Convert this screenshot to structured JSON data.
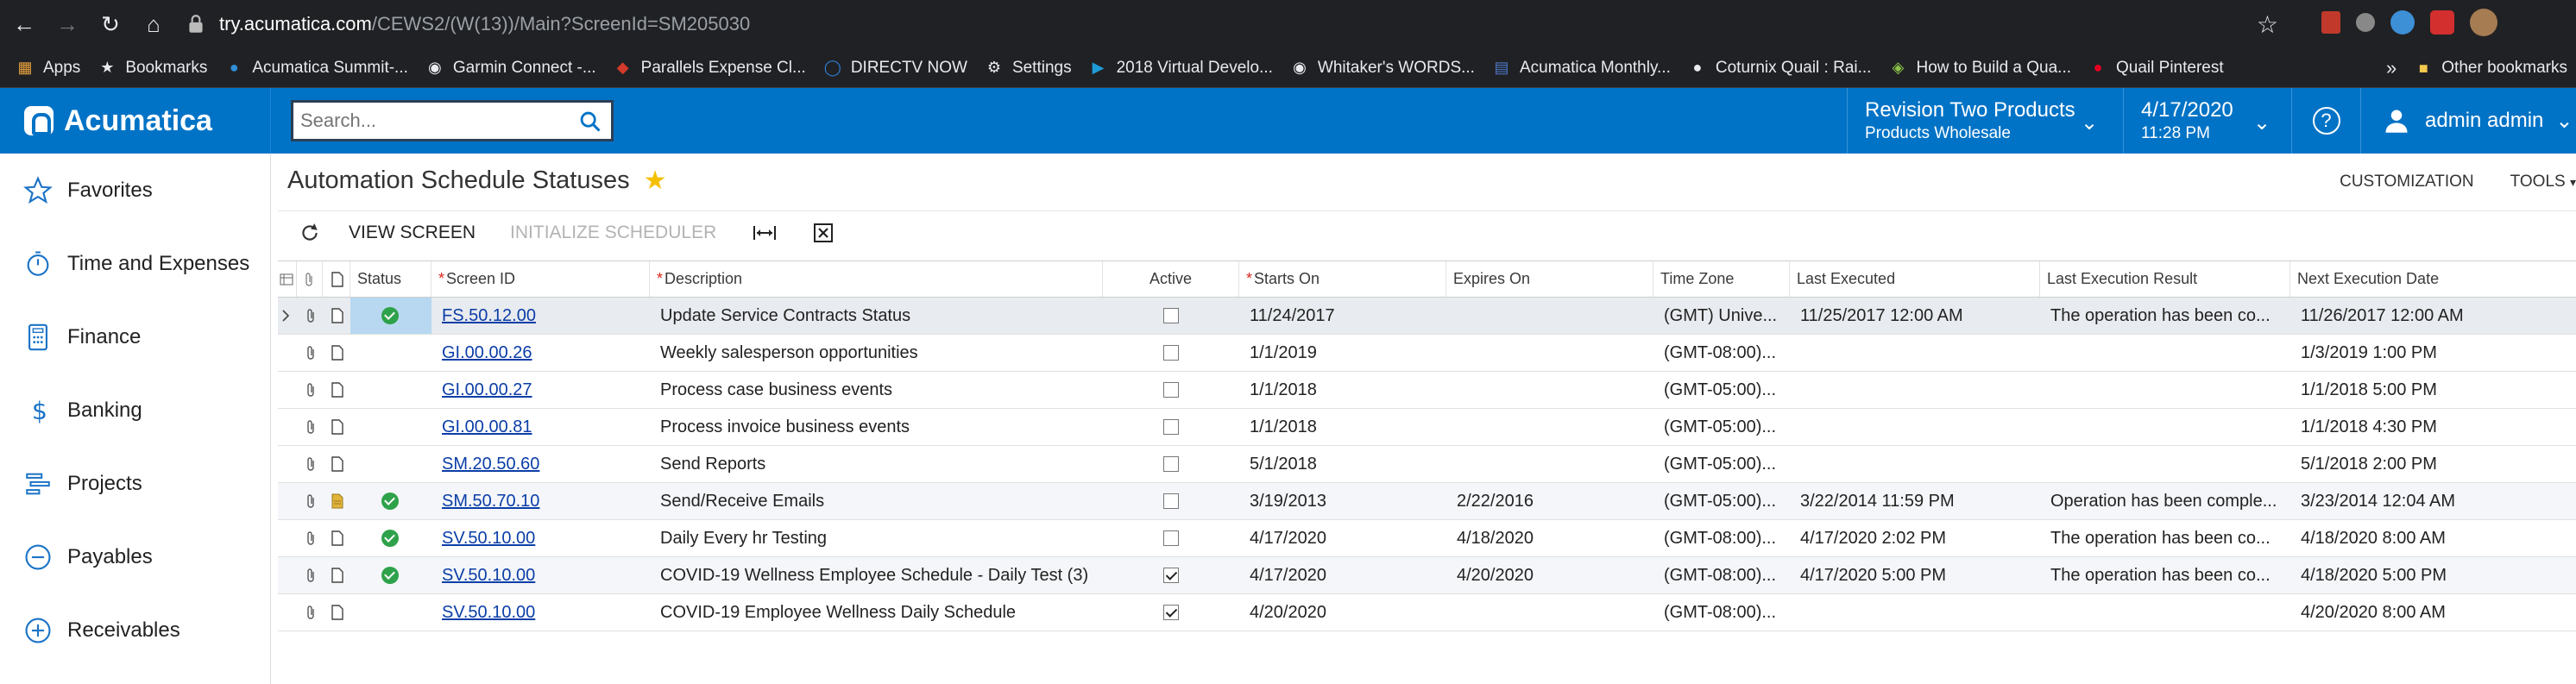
{
  "browser": {
    "url_host": "try.acumatica.com",
    "url_path": "/CEWS2/(W(13))/Main?ScreenId=SM205030",
    "bookmarks": [
      {
        "label": "Apps",
        "icon": "apps-grid-icon"
      },
      {
        "label": "Bookmarks",
        "icon": "star-icon"
      },
      {
        "label": "Acumatica Summit-...",
        "icon": "acumatica-icon"
      },
      {
        "label": "Garmin Connect -...",
        "icon": "globe-icon"
      },
      {
        "label": "Parallels Expense Cl...",
        "icon": "parallels-icon"
      },
      {
        "label": "DIRECTV NOW",
        "icon": "directv-icon"
      },
      {
        "label": "Settings",
        "icon": "gear-icon"
      },
      {
        "label": "2018 Virtual Develo...",
        "icon": "play-icon"
      },
      {
        "label": "Whitaker's WORDS...",
        "icon": "globe-icon"
      },
      {
        "label": "Acumatica Monthly...",
        "icon": "document-icon"
      },
      {
        "label": "Coturnix Quail : Rai...",
        "icon": "quail-icon"
      },
      {
        "label": "How to Build a Qua...",
        "icon": "leaf-icon"
      },
      {
        "label": "Quail Pinterest",
        "icon": "pinterest-icon"
      }
    ],
    "more_bookmarks": "»",
    "other_bookmarks": "Other bookmarks"
  },
  "header": {
    "logo": "Acumatica",
    "search_placeholder": "Search...",
    "branch_line1": "Revision Two Products",
    "branch_line2": "Products Wholesale",
    "date_line1": "4/17/2020",
    "date_line2": "11:28 PM",
    "user": "admin admin",
    "colors": {
      "primary": "#0073c6"
    }
  },
  "sidebar": {
    "items": [
      {
        "label": "Favorites",
        "icon": "star-outline-icon"
      },
      {
        "label": "Time and Expenses",
        "icon": "stopwatch-icon"
      },
      {
        "label": "Finance",
        "icon": "calculator-icon"
      },
      {
        "label": "Banking",
        "icon": "dollar-icon"
      },
      {
        "label": "Projects",
        "icon": "projects-icon"
      },
      {
        "label": "Payables",
        "icon": "minus-circle-icon"
      },
      {
        "label": "Receivables",
        "icon": "plus-circle-icon"
      }
    ]
  },
  "page": {
    "title": "Automation Schedule Statuses",
    "customization": "CUSTOMIZATION",
    "tools": "TOOLS",
    "toolbar": {
      "view_screen": "VIEW SCREEN",
      "initialize_scheduler": "INITIALIZE SCHEDULER"
    }
  },
  "grid": {
    "columns": {
      "status": "Status",
      "screen_id": "Screen ID",
      "description": "Description",
      "active": "Active",
      "starts_on": "Starts On",
      "expires_on": "Expires On",
      "time_zone": "Time Zone",
      "last_executed": "Last Executed",
      "last_result": "Last Execution Result",
      "next_execution": "Next Execution Date"
    },
    "rows": [
      {
        "status_ok": true,
        "screen_id": "FS.50.12.00",
        "description": "Update Service Contracts Status",
        "active": false,
        "starts_on": "11/24/2017",
        "expires_on": "",
        "time_zone": "(GMT) Unive...",
        "last_executed": "11/25/2017 12:00 AM",
        "last_result": "The operation has been co...",
        "next_execution": "11/26/2017 12:00 AM",
        "note_icon": "document-icon"
      },
      {
        "status_ok": false,
        "screen_id": "GI.00.00.26",
        "description": "Weekly salesperson opportunities",
        "active": false,
        "starts_on": "1/1/2019",
        "expires_on": "",
        "time_zone": "(GMT-08:00)...",
        "last_executed": "",
        "last_result": "",
        "next_execution": "1/3/2019 1:00 PM",
        "note_icon": "document-icon"
      },
      {
        "status_ok": false,
        "screen_id": "GI.00.00.27",
        "description": "Process case business events",
        "active": false,
        "starts_on": "1/1/2018",
        "expires_on": "",
        "time_zone": "(GMT-05:00)...",
        "last_executed": "",
        "last_result": "",
        "next_execution": "1/1/2018 5:00 PM",
        "note_icon": "document-icon"
      },
      {
        "status_ok": false,
        "screen_id": "GI.00.00.81",
        "description": "Process invoice business events",
        "active": false,
        "starts_on": "1/1/2018",
        "expires_on": "",
        "time_zone": "(GMT-05:00)...",
        "last_executed": "",
        "last_result": "",
        "next_execution": "1/1/2018 4:30 PM",
        "note_icon": "document-icon"
      },
      {
        "status_ok": false,
        "screen_id": "SM.20.50.60",
        "description": "Send Reports",
        "active": false,
        "starts_on": "5/1/2018",
        "expires_on": "",
        "time_zone": "(GMT-05:00)...",
        "last_executed": "",
        "last_result": "",
        "next_execution": "5/1/2018 2:00 PM",
        "note_icon": "document-icon"
      },
      {
        "status_ok": true,
        "screen_id": "SM.50.70.10",
        "description": "Send/Receive Emails",
        "active": false,
        "starts_on": "3/19/2013",
        "expires_on": "2/22/2016",
        "time_zone": "(GMT-05:00)...",
        "last_executed": "3/22/2014 11:59 PM",
        "last_result": "Operation has been comple...",
        "next_execution": "3/23/2014 12:04 AM",
        "note_icon": "note-filled-icon"
      },
      {
        "status_ok": true,
        "screen_id": "SV.50.10.00",
        "description": "Daily Every hr Testing",
        "active": false,
        "starts_on": "4/17/2020",
        "expires_on": "4/18/2020",
        "time_zone": "(GMT-08:00)...",
        "last_executed": "4/17/2020 2:02 PM",
        "last_result": "The operation has been co...",
        "next_execution": "4/18/2020 8:00 AM",
        "note_icon": "document-icon"
      },
      {
        "status_ok": true,
        "screen_id": "SV.50.10.00",
        "description": "COVID-19 Wellness Employee Schedule - Daily Test (3)",
        "active": true,
        "starts_on": "4/17/2020",
        "expires_on": "4/20/2020",
        "time_zone": "(GMT-08:00)...",
        "last_executed": "4/17/2020 5:00 PM",
        "last_result": "The operation has been co...",
        "next_execution": "4/18/2020 5:00 PM",
        "note_icon": "document-icon"
      },
      {
        "status_ok": false,
        "screen_id": "SV.50.10.00",
        "description": "COVID-19 Employee Wellness Daily Schedule",
        "active": true,
        "starts_on": "4/20/2020",
        "expires_on": "",
        "time_zone": "(GMT-08:00)...",
        "last_executed": "",
        "last_result": "",
        "next_execution": "4/20/2020 8:00 AM",
        "note_icon": "document-icon"
      }
    ]
  }
}
